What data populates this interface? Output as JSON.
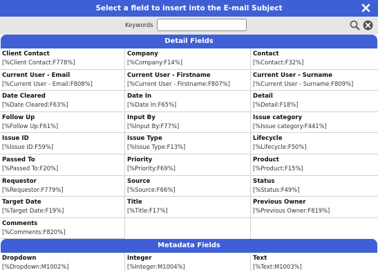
{
  "dialog": {
    "title": "Select a field to insert into the E-mail Subject"
  },
  "search": {
    "label": "Keywords",
    "value": "",
    "placeholder": ""
  },
  "detail": {
    "header": "Detail Fields",
    "fields": [
      {
        "name": "Client Contact",
        "code": "[%Client Contact:F778%]"
      },
      {
        "name": "Company",
        "code": "[%Company:F14%]"
      },
      {
        "name": "Contact",
        "code": "[%Contact:F32%]"
      },
      {
        "name": "Current User - Email",
        "code": "[%Current User - Email:F808%]"
      },
      {
        "name": "Current User - Firstname",
        "code": "[%Current User - Firstname:F807%]"
      },
      {
        "name": "Current User - Surname",
        "code": "[%Current User - Surname:F809%]"
      },
      {
        "name": "Date Cleared",
        "code": "[%Date Cleared:F63%]"
      },
      {
        "name": "Date In",
        "code": "[%Date In:F65%]"
      },
      {
        "name": "Detail",
        "code": "[%Detail:F18%]"
      },
      {
        "name": "Follow Up",
        "code": "[%Follow Up:F61%]"
      },
      {
        "name": "Input By",
        "code": "[%Input By:F77%]"
      },
      {
        "name": "Issue category",
        "code": "[%Issue category:F441%]"
      },
      {
        "name": "Issue ID",
        "code": "[%Issue ID:F59%]"
      },
      {
        "name": "Issue Type",
        "code": "[%Issue Type:F13%]"
      },
      {
        "name": "Lifecycle",
        "code": "[%Lifecycle:F50%]"
      },
      {
        "name": "Passed To",
        "code": "[%Passed To:F20%]"
      },
      {
        "name": "Priority",
        "code": "[%Priority:F69%]"
      },
      {
        "name": "Product",
        "code": "[%Product:F15%]"
      },
      {
        "name": "Requestor",
        "code": "[%Requestor:F779%]"
      },
      {
        "name": "Source",
        "code": "[%Source:F66%]"
      },
      {
        "name": "Status",
        "code": "[%Status:F49%]"
      },
      {
        "name": "Target Date",
        "code": "[%Target Date:F19%]"
      },
      {
        "name": "Title",
        "code": "[%Title:F17%]"
      },
      {
        "name": "Previous Owner",
        "code": "[%Previous Owner:F819%]"
      },
      {
        "name": "Comments",
        "code": "[%Comments:F820%]"
      }
    ]
  },
  "metadata": {
    "header": "Metadata Fields",
    "fields": [
      {
        "name": "Dropdown",
        "code": "[%Dropdown:M1002%]"
      },
      {
        "name": "Integer",
        "code": "[%Integer:M1004%]"
      },
      {
        "name": "Text",
        "code": "[%Text:M1003%]"
      }
    ]
  },
  "icons": {
    "close": "close-icon",
    "search": "search-icon",
    "clear": "clear-search-icon"
  },
  "colors": {
    "accent": "#3f5fd6",
    "toolbar": "#e6e6e6"
  }
}
